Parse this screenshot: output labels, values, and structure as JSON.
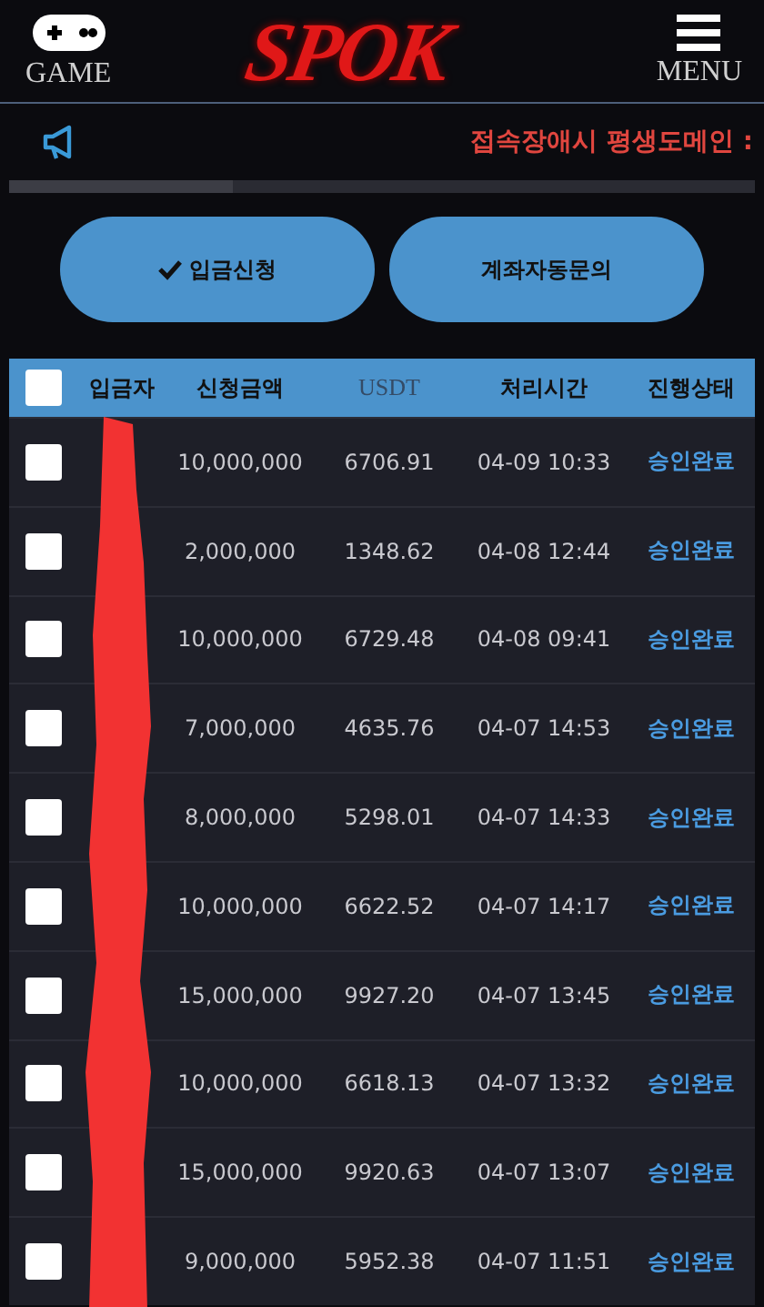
{
  "header": {
    "left_label": "GAME",
    "logo": "SPOK",
    "right_label": "MENU"
  },
  "notice": {
    "text": "접속장애시 평생도메인 :"
  },
  "buttons": [
    {
      "label": "입금신청",
      "kind": "check"
    },
    {
      "label": "계좌자동문의",
      "kind": "plain"
    }
  ],
  "table": {
    "select_all": {
      "checked": false
    },
    "columns": [
      "입금자",
      "신청금액",
      "USDT",
      "처리시간",
      "진행상태"
    ],
    "rows": [
      {
        "checked": false,
        "amount": "10,000,000",
        "usdt": "6706.91",
        "time": "04-09 10:33",
        "status": "승인완료"
      },
      {
        "checked": false,
        "amount": "2,000,000",
        "usdt": "1348.62",
        "time": "04-08 12:44",
        "status": "승인완료"
      },
      {
        "checked": false,
        "amount": "10,000,000",
        "usdt": "6729.48",
        "time": "04-08 09:41",
        "status": "승인완료"
      },
      {
        "checked": false,
        "amount": "7,000,000",
        "usdt": "4635.76",
        "time": "04-07 14:53",
        "status": "승인완료"
      },
      {
        "checked": false,
        "amount": "8,000,000",
        "usdt": "5298.01",
        "time": "04-07 14:33",
        "status": "승인완료"
      },
      {
        "checked": false,
        "amount": "10,000,000",
        "usdt": "6622.52",
        "time": "04-07 14:17",
        "status": "승인완료"
      },
      {
        "checked": false,
        "amount": "15,000,000",
        "usdt": "9927.20",
        "time": "04-07 13:45",
        "status": "승인완료"
      },
      {
        "checked": false,
        "amount": "10,000,000",
        "usdt": "6618.13",
        "time": "04-07 13:32",
        "status": "승인완료"
      },
      {
        "checked": false,
        "amount": "15,000,000",
        "usdt": "9920.63",
        "time": "04-07 13:07",
        "status": "승인완료"
      },
      {
        "checked": false,
        "amount": "9,000,000",
        "usdt": "5952.38",
        "time": "04-07 11:51",
        "status": "승인완료"
      }
    ]
  }
}
